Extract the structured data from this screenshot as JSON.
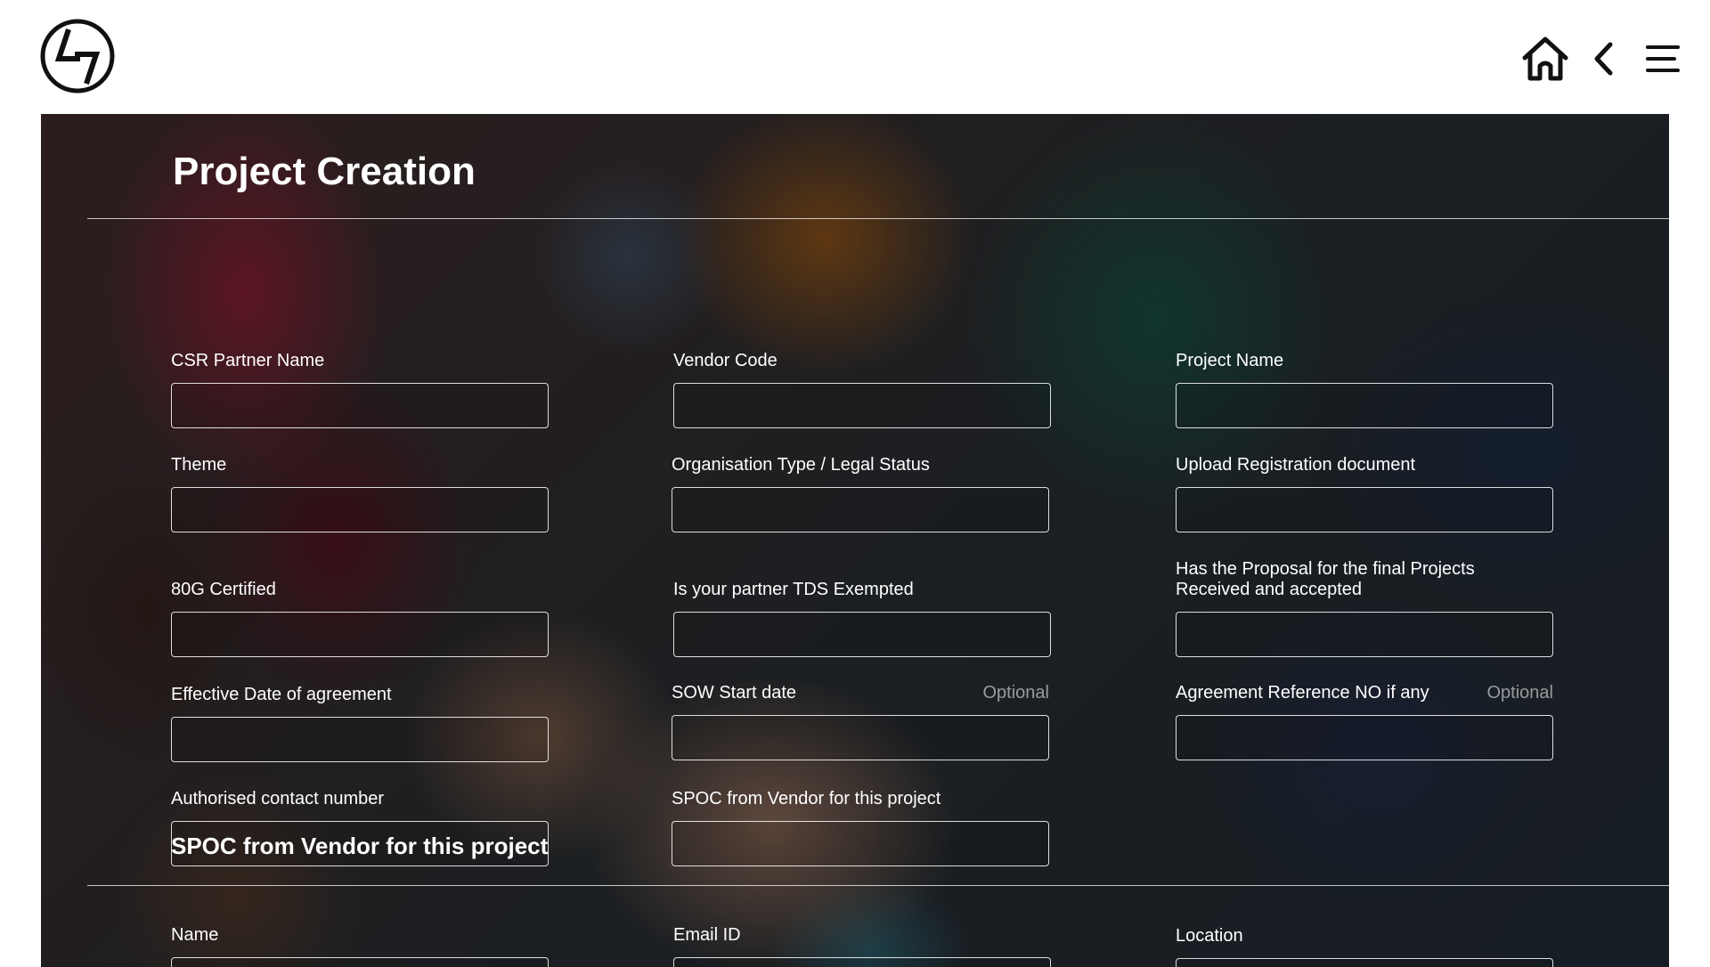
{
  "page": {
    "title": "Project Creation",
    "section_title": "SPOC from Vendor for this project"
  },
  "header": {
    "logo_icon": "lt-logo-icon",
    "home_icon": "home-icon",
    "back_icon": "chevron-left-icon",
    "menu_icon": "hamburger-menu-icon"
  },
  "fields": {
    "csr_partner_name": {
      "label": "CSR Partner Name",
      "value": ""
    },
    "vendor_code": {
      "label": "Vendor Code",
      "value": ""
    },
    "project_name": {
      "label": "Project Name",
      "value": ""
    },
    "theme": {
      "label": "Theme",
      "value": ""
    },
    "organisation_type": {
      "label": "Organisation Type / Legal Status",
      "value": ""
    },
    "upload_registration": {
      "label": "Upload Registration document",
      "value": ""
    },
    "certified_80g": {
      "label": "80G Certified",
      "value": ""
    },
    "tds_exempted": {
      "label": "Is your partner TDS Exempted",
      "value": ""
    },
    "proposal_accepted": {
      "label": "Has the Proposal for the final Projects Received and accepted",
      "value": ""
    },
    "effective_date": {
      "label": "Effective Date of agreement",
      "value": ""
    },
    "sow_start_date": {
      "label": "SOW Start date",
      "optional": "Optional",
      "value": ""
    },
    "agreement_reference": {
      "label": "Agreement Reference NO if any",
      "optional": "Optional",
      "value": ""
    },
    "authorised_contact": {
      "label": "Authorised contact number",
      "value": ""
    },
    "spoc_vendor": {
      "label": "SPOC from Vendor for this project",
      "value": ""
    },
    "spoc_name": {
      "label": "Name",
      "value": ""
    },
    "spoc_email": {
      "label": "Email ID",
      "value": ""
    },
    "spoc_location": {
      "label": "Location",
      "value": ""
    }
  },
  "colors": {
    "text": "#ffffff",
    "overlay": "rgba(0,0,0,0.5)",
    "background": "#ffffff"
  }
}
